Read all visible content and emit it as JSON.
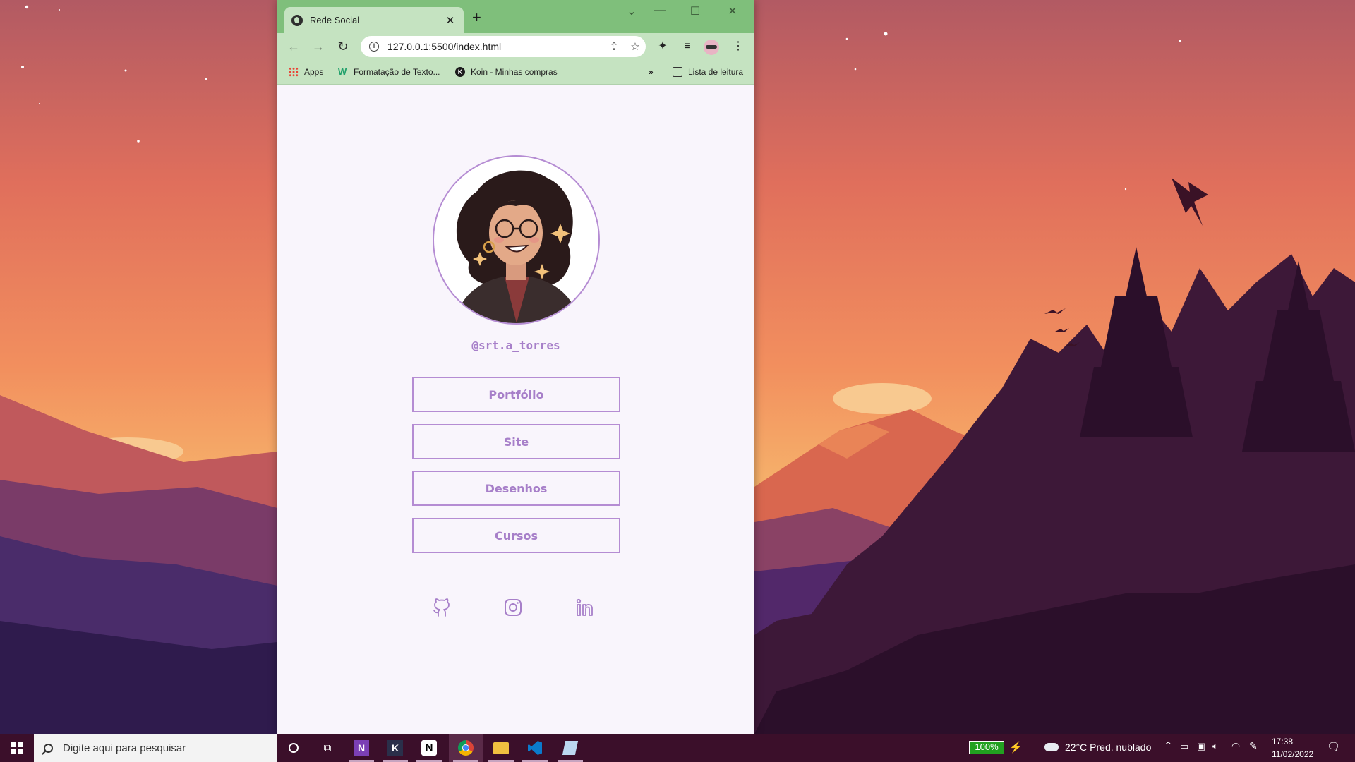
{
  "browser": {
    "tab_title": "Rede Social",
    "url": "127.0.0.1:5500/index.html",
    "bookmarks": [
      {
        "label": "Apps",
        "icon": "apps-grid-icon"
      },
      {
        "label": "Formatação de Texto...",
        "icon": "w-icon"
      },
      {
        "label": "Koin - Minhas compras",
        "icon": "k-icon"
      }
    ],
    "reading_list": "Lista de leitura",
    "theme_color": "#7fbf7b",
    "toolbar_color": "#c5e3c1"
  },
  "page": {
    "handle": "@srt.a_torres",
    "accent": "#a77fc9",
    "links": [
      "Portfólio",
      "Site",
      "Desenhos",
      "Cursos"
    ],
    "social_icons": [
      "github-icon",
      "instagram-icon",
      "linkedin-icon"
    ]
  },
  "taskbar": {
    "search_placeholder": "Digite aqui para pesquisar",
    "battery": "100%",
    "weather": "22°C  Pred. nublado",
    "time": "17:38",
    "date": "11/02/2022",
    "background": "#3b0f2a"
  }
}
